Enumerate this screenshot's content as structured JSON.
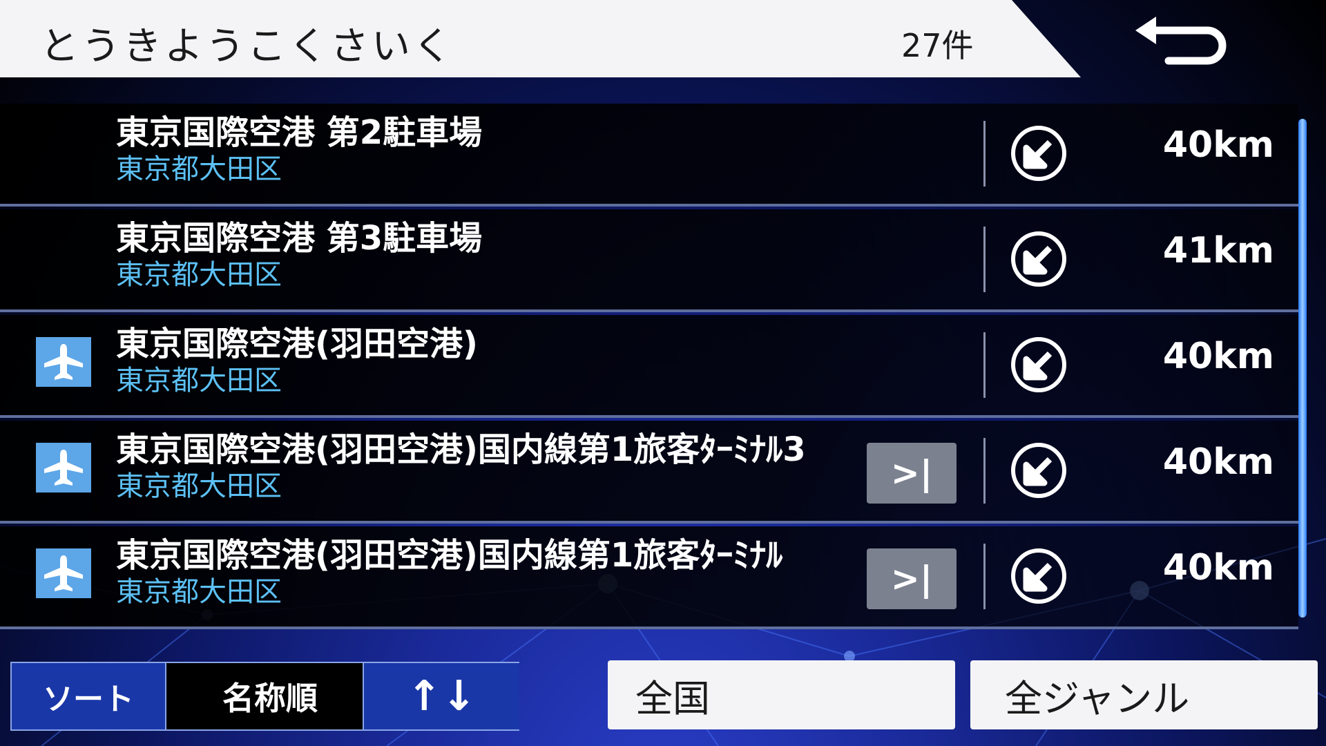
{
  "header": {
    "title": "とうきようこくさいく",
    "count": "27件",
    "back_icon": "return-arrow-icon"
  },
  "results": [
    {
      "name": "東京国際空港 第2駐車場",
      "address": "東京都大田区",
      "distance": "40km",
      "category_icon": null,
      "has_more": false,
      "direction_icon": "direction-arrow-icon"
    },
    {
      "name": "東京国際空港 第3駐車場",
      "address": "東京都大田区",
      "distance": "41km",
      "category_icon": null,
      "has_more": false,
      "direction_icon": "direction-arrow-icon"
    },
    {
      "name": "東京国際空港(羽田空港)",
      "address": "東京都大田区",
      "distance": "40km",
      "category_icon": "airport-icon",
      "has_more": false,
      "direction_icon": "direction-arrow-icon"
    },
    {
      "name": "東京国際空港(羽田空港)国内線第1旅客ﾀｰﾐﾅﾙ3",
      "address": "東京都大田区",
      "distance": "40km",
      "category_icon": "airport-icon",
      "has_more": true,
      "more_label": ">|",
      "direction_icon": "direction-arrow-icon"
    },
    {
      "name": "東京国際空港(羽田空港)国内線第1旅客ﾀｰﾐﾅﾙ",
      "address": "東京都大田区",
      "distance": "40km",
      "category_icon": "airport-icon",
      "has_more": true,
      "more_label": ">|",
      "direction_icon": "direction-arrow-icon"
    }
  ],
  "sort": {
    "label": "ソート",
    "value": "名称順",
    "toggle": "↑↓"
  },
  "filters": {
    "region": "全国",
    "genre": "全ジャンル"
  },
  "colors": {
    "address": "#5cc0f4",
    "accent": "#1a37a8",
    "icon_bg": "#5da6e8"
  }
}
